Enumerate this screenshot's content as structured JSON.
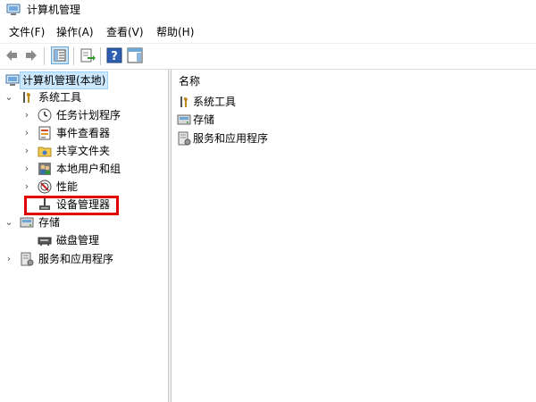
{
  "window": {
    "title": "计算机管理"
  },
  "menu": {
    "items": [
      "文件(F)",
      "操作(A)",
      "查看(V)",
      "帮助(H)"
    ]
  },
  "tree": {
    "root": "计算机管理(本地)",
    "system_tools": "系统工具",
    "task_scheduler": "任务计划程序",
    "event_viewer": "事件查看器",
    "shared_folders": "共享文件夹",
    "local_users": "本地用户和组",
    "performance": "性能",
    "device_manager": "设备管理器",
    "storage": "存储",
    "disk_management": "磁盘管理",
    "services_apps": "服务和应用程序"
  },
  "right": {
    "header": "名称",
    "items": [
      "系统工具",
      "存储",
      "服务和应用程序"
    ]
  },
  "colors": {
    "highlight": "#e00000",
    "selection": "#cce8ff"
  }
}
